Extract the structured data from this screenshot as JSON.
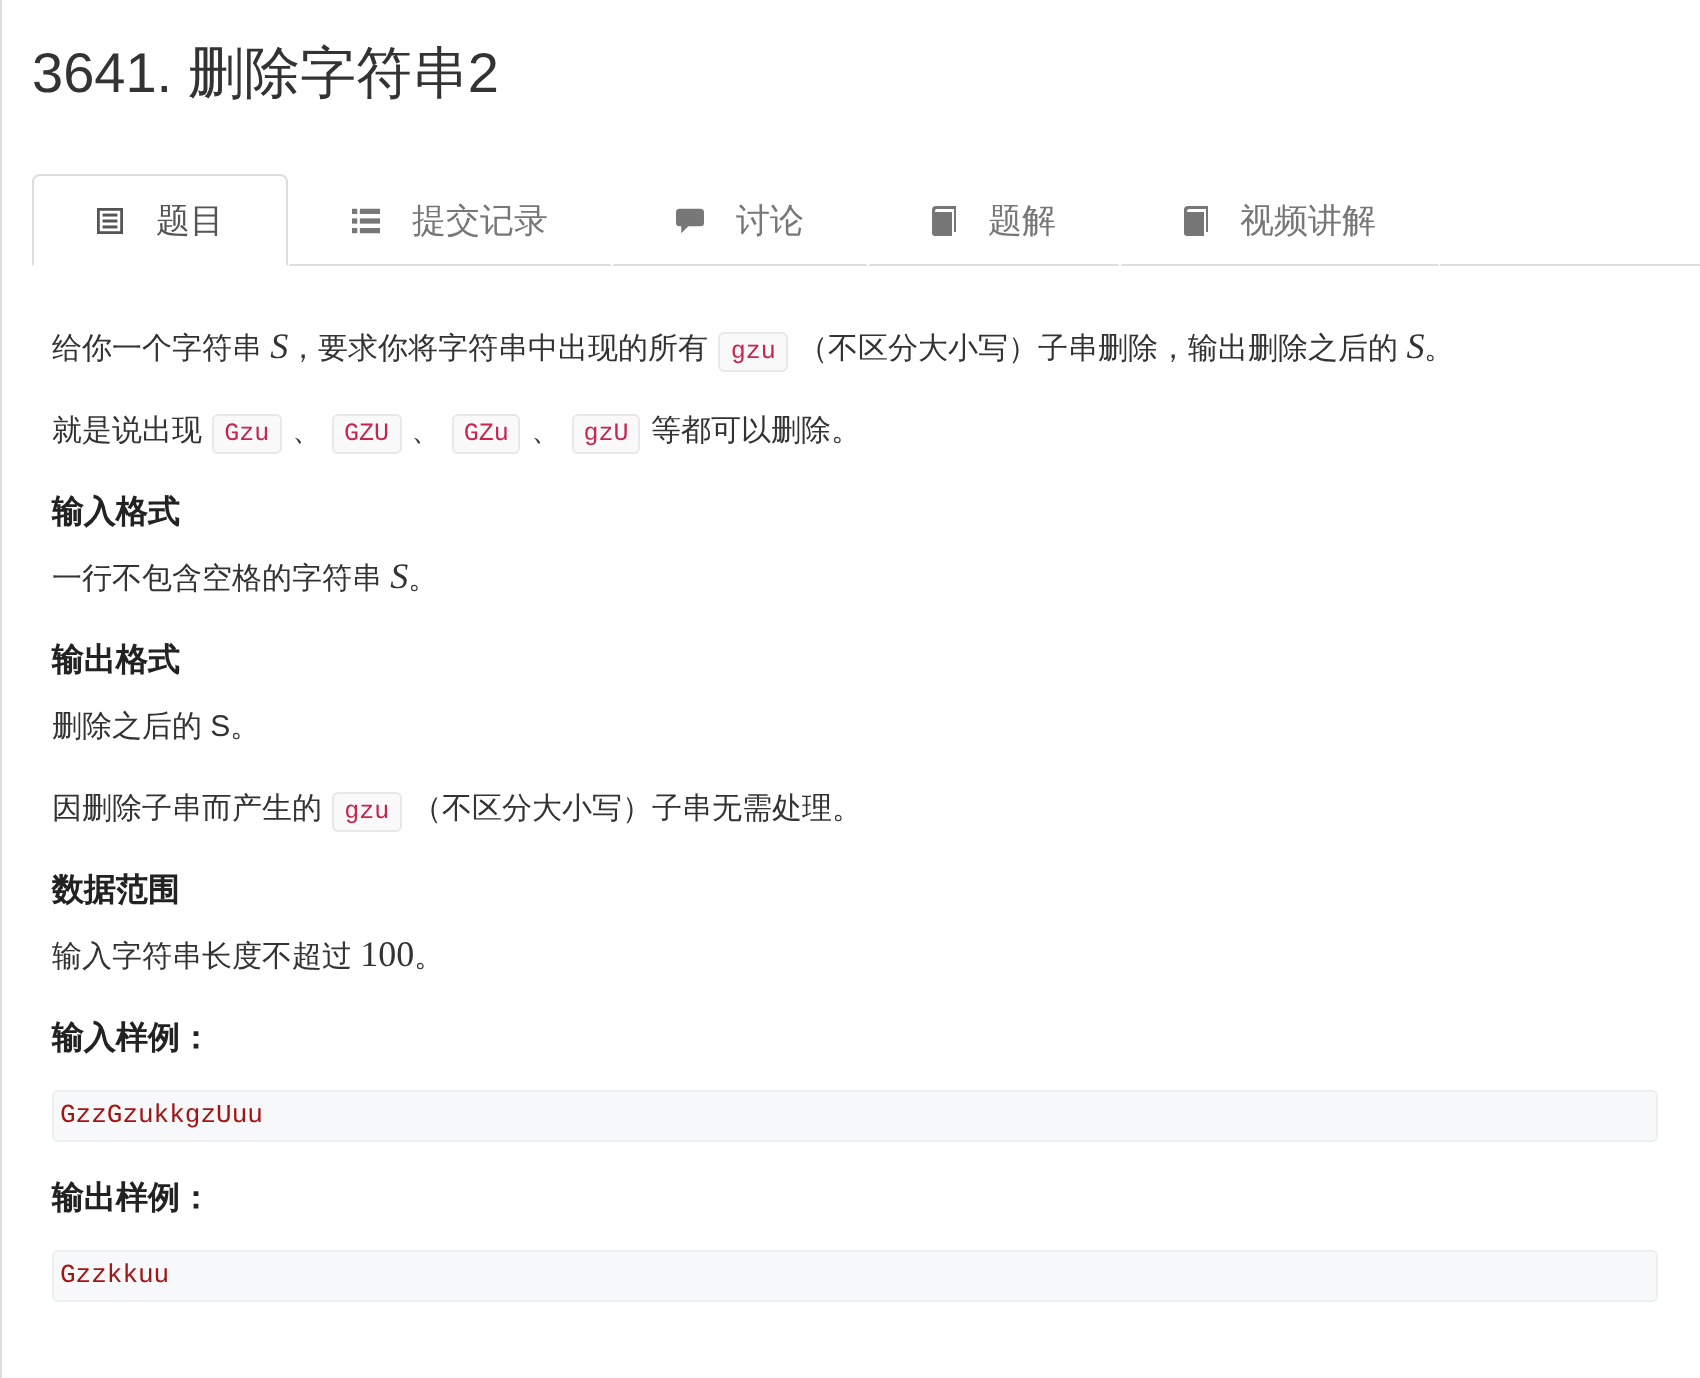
{
  "title": "3641. 删除字符串2",
  "tabs": [
    {
      "label": "题目",
      "selected": true,
      "kind": "document"
    },
    {
      "label": "提交记录",
      "selected": false,
      "kind": "list"
    },
    {
      "label": "讨论",
      "selected": false,
      "kind": "comment"
    },
    {
      "label": "题解",
      "selected": false,
      "kind": "book"
    },
    {
      "label": "视频讲解",
      "selected": false,
      "kind": "book"
    }
  ],
  "content": [
    {
      "kind": "paragraph",
      "parts": [
        {
          "kind": "text",
          "text": "给你一个字符串 "
        },
        {
          "kind": "variable",
          "text": "S"
        },
        {
          "kind": "text",
          "text": "，要求你将字符串中出现的所有 "
        },
        {
          "kind": "code",
          "text": "gzu"
        },
        {
          "kind": "text",
          "text": " （不区分大小写）子串删除，输出删除之后的 "
        },
        {
          "kind": "variable",
          "text": "S"
        },
        {
          "kind": "text",
          "text": "。"
        }
      ]
    },
    {
      "kind": "paragraph",
      "parts": [
        {
          "kind": "text",
          "text": "就是说出现 "
        },
        {
          "kind": "code",
          "text": "Gzu"
        },
        {
          "kind": "text",
          "text": " 、 "
        },
        {
          "kind": "code",
          "text": "GZU"
        },
        {
          "kind": "text",
          "text": " 、 "
        },
        {
          "kind": "code",
          "text": "GZu"
        },
        {
          "kind": "text",
          "text": " 、 "
        },
        {
          "kind": "code",
          "text": "gzU"
        },
        {
          "kind": "text",
          "text": " 等都可以删除。"
        }
      ]
    },
    {
      "kind": "heading",
      "text": "输入格式"
    },
    {
      "kind": "paragraph",
      "parts": [
        {
          "kind": "text",
          "text": "一行不包含空格的字符串 "
        },
        {
          "kind": "variable",
          "text": "S"
        },
        {
          "kind": "text",
          "text": "。"
        }
      ]
    },
    {
      "kind": "heading",
      "text": "输出格式"
    },
    {
      "kind": "paragraph",
      "parts": [
        {
          "kind": "text",
          "text": "删除之后的 S。"
        }
      ]
    },
    {
      "kind": "paragraph",
      "parts": [
        {
          "kind": "text",
          "text": "因删除子串而产生的 "
        },
        {
          "kind": "code",
          "text": "gzu"
        },
        {
          "kind": "text",
          "text": " （不区分大小写）子串无需处理。"
        }
      ]
    },
    {
      "kind": "heading",
      "text": "数据范围"
    },
    {
      "kind": "paragraph",
      "parts": [
        {
          "kind": "text",
          "text": "输入字符串长度不超过 "
        },
        {
          "kind": "number",
          "text": "100"
        },
        {
          "kind": "text",
          "text": "。"
        }
      ]
    },
    {
      "kind": "heading",
      "text": "输入样例："
    },
    {
      "kind": "sample",
      "text": "GzzGzukkgzUuu"
    },
    {
      "kind": "heading",
      "text": "输出样例："
    },
    {
      "kind": "sample",
      "text": "Gzzkkuu"
    }
  ]
}
